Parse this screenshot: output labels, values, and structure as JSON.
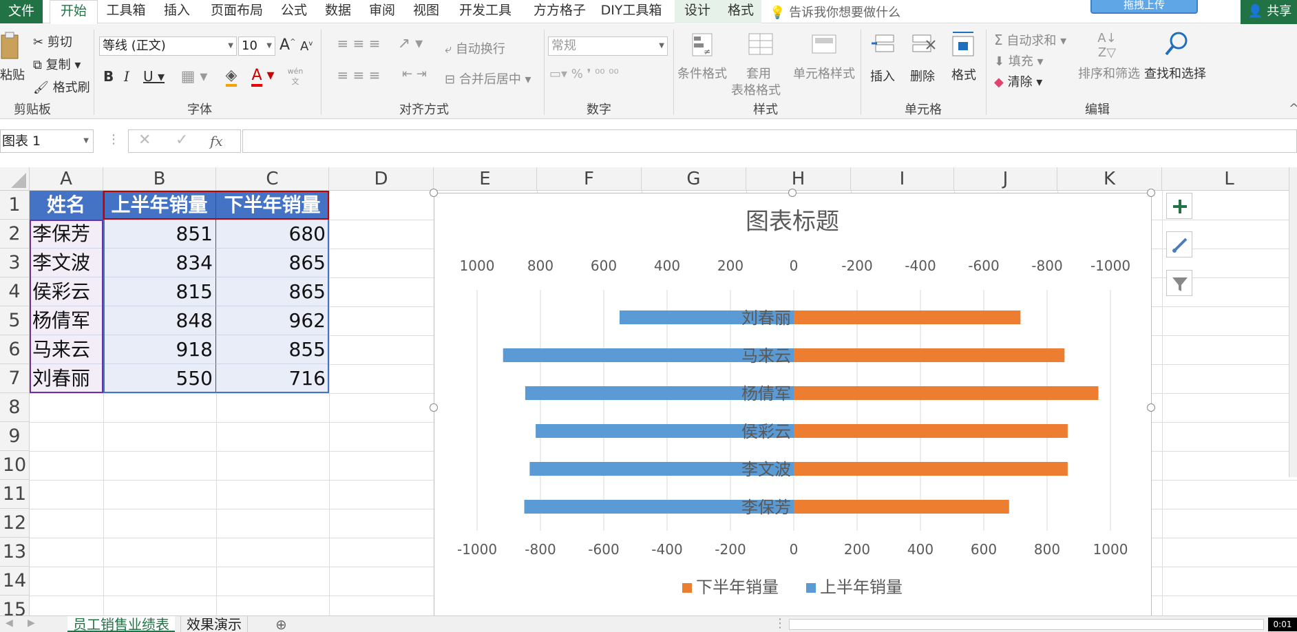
{
  "menu": {
    "file": "文件",
    "tabs": [
      "开始",
      "工具箱",
      "插入",
      "页面布局",
      "公式",
      "数据",
      "审阅",
      "视图",
      "开发工具",
      "方方格子",
      "DIY工具箱",
      "设计",
      "格式"
    ],
    "tell_me": "告诉我你想要做什么",
    "upload": "拖拽上传",
    "share": "共享"
  },
  "ribbon": {
    "clipboard": {
      "paste": "粘贴",
      "cut": "剪切",
      "copy": "复制",
      "format_painter": "格式刷",
      "label": "剪贴板"
    },
    "font": {
      "name": "等线 (正文)",
      "size": "10",
      "label": "字体",
      "phonetic": "wén"
    },
    "alignment": {
      "wrap": "自动换行",
      "merge": "合并后居中",
      "label": "对齐方式"
    },
    "number": {
      "format": "常规",
      "label": "数字"
    },
    "styles": {
      "conditional": "条件格式",
      "table1": "套用",
      "table2": "表格格式",
      "cell_styles": "单元格样式",
      "label": "样式"
    },
    "cells": {
      "insert": "插入",
      "delete": "删除",
      "format": "格式",
      "label": "单元格"
    },
    "editing": {
      "autosum": "自动求和",
      "fill": "填充",
      "clear": "清除",
      "sort": "排序和筛选",
      "find": "查找和选择",
      "label": "编辑"
    }
  },
  "formula_bar": {
    "name_box": "图表 1",
    "fx": "fx",
    "value": ""
  },
  "columns": [
    "A",
    "B",
    "C",
    "D",
    "E",
    "F",
    "G",
    "H",
    "I",
    "J",
    "K",
    "L"
  ],
  "rows": [
    "1",
    "2",
    "3",
    "4",
    "5",
    "6",
    "7",
    "8",
    "9",
    "10",
    "11",
    "12",
    "13",
    "14",
    "15"
  ],
  "table": {
    "headers": [
      "姓名",
      "上半年销量",
      "下半年销量"
    ],
    "data": [
      [
        "李保芳",
        "851",
        "680"
      ],
      [
        "李文波",
        "834",
        "865"
      ],
      [
        "侯彩云",
        "815",
        "865"
      ],
      [
        "杨倩军",
        "848",
        "962"
      ],
      [
        "马来云",
        "918",
        "855"
      ],
      [
        "刘春丽",
        "550",
        "716"
      ]
    ]
  },
  "sheets": [
    "员工销售业绩表",
    "效果演示"
  ],
  "status": "0:01",
  "chart_data": {
    "type": "bar",
    "orientation": "horizontal",
    "title": "图表标题",
    "categories": [
      "刘春丽",
      "马来云",
      "杨倩军",
      "侯彩云",
      "李文波",
      "李保芳"
    ],
    "series": [
      {
        "name": "上半年销量",
        "color": "#5b9bd5",
        "values": [
          -550,
          -918,
          -848,
          -815,
          -834,
          -851
        ]
      },
      {
        "name": "下半年销量",
        "color": "#ed7d31",
        "values": [
          716,
          855,
          962,
          865,
          865,
          680
        ]
      }
    ],
    "xlim": [
      -1000,
      1000
    ],
    "top_ticks": [
      "1000",
      "800",
      "600",
      "400",
      "200",
      "0",
      "-200",
      "-400",
      "-600",
      "-800",
      "-1000"
    ],
    "bottom_ticks": [
      "-1000",
      "-800",
      "-600",
      "-400",
      "-200",
      "0",
      "200",
      "400",
      "600",
      "800",
      "1000"
    ],
    "legend": [
      "下半年销量",
      "上半年销量"
    ],
    "legend_position": "bottom",
    "grid": true
  }
}
